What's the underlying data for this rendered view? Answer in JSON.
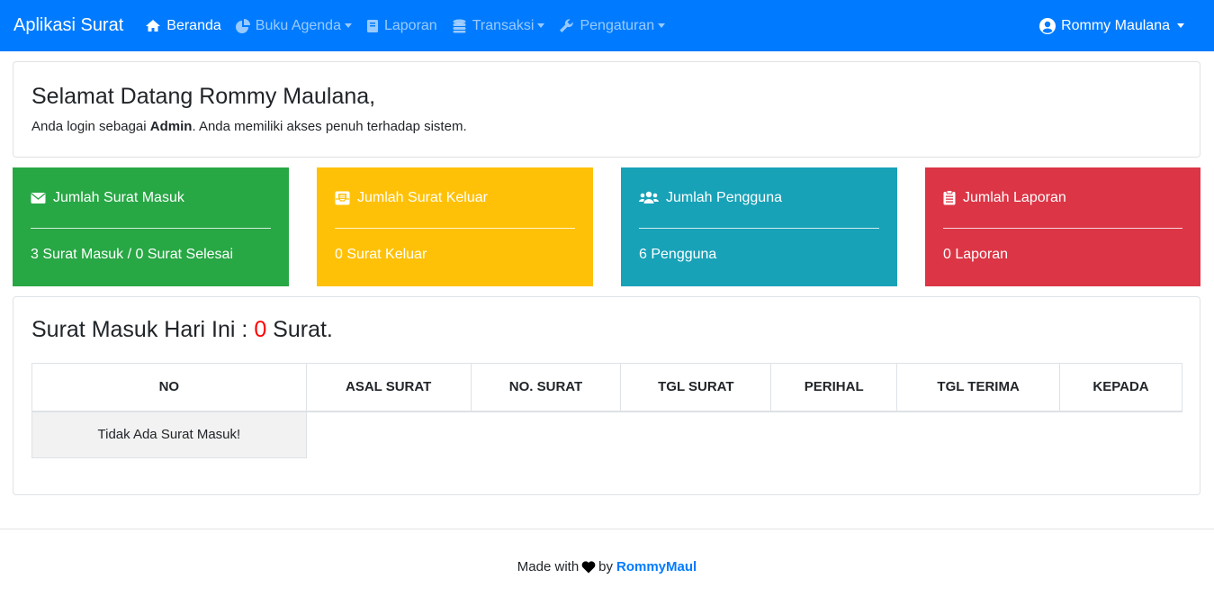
{
  "navbar": {
    "brand": "Aplikasi Surat",
    "items": [
      {
        "label": "Beranda",
        "icon": "home-icon",
        "active": true,
        "dropdown": false
      },
      {
        "label": "Buku Agenda",
        "icon": "pie-chart-icon",
        "active": false,
        "dropdown": true
      },
      {
        "label": "Laporan",
        "icon": "book-icon",
        "active": false,
        "dropdown": false
      },
      {
        "label": "Transaksi",
        "icon": "coins-icon",
        "active": false,
        "dropdown": true
      },
      {
        "label": "Pengaturan",
        "icon": "wrench-icon",
        "active": false,
        "dropdown": true
      }
    ],
    "user": "Rommy Maulana",
    "accent": "#007bff"
  },
  "welcome": {
    "title": "Selamat Datang Rommy Maulana,",
    "text_before": "Anda login sebagai ",
    "role": "Admin",
    "text_after": ". Anda memiliki akses penuh terhadap sistem."
  },
  "stats": [
    {
      "title": "Jumlah Surat Masuk",
      "value": "3 Surat Masuk / 0 Surat Selesai",
      "icon": "envelope-icon",
      "color": "#28a745"
    },
    {
      "title": "Jumlah Surat Keluar",
      "value": "0 Surat Keluar",
      "icon": "envelope-open-icon",
      "color": "#ffc107"
    },
    {
      "title": "Jumlah Pengguna",
      "value": "6 Pengguna",
      "icon": "users-icon",
      "color": "#17a2b8"
    },
    {
      "title": "Jumlah Laporan",
      "value": "0 Laporan",
      "icon": "clipboard-icon",
      "color": "#dc3545"
    }
  ],
  "today": {
    "prefix": "Surat Masuk Hari Ini : ",
    "count": "0",
    "suffix": " Surat.",
    "columns": [
      "NO",
      "ASAL SURAT",
      "NO. SURAT",
      "TGL SURAT",
      "PERIHAL",
      "TGL TERIMA",
      "KEPADA"
    ],
    "empty_message": "Tidak Ada Surat Masuk!"
  },
  "footer": {
    "made_with": "Made with",
    "by": "by",
    "author": "RommyMaul"
  }
}
